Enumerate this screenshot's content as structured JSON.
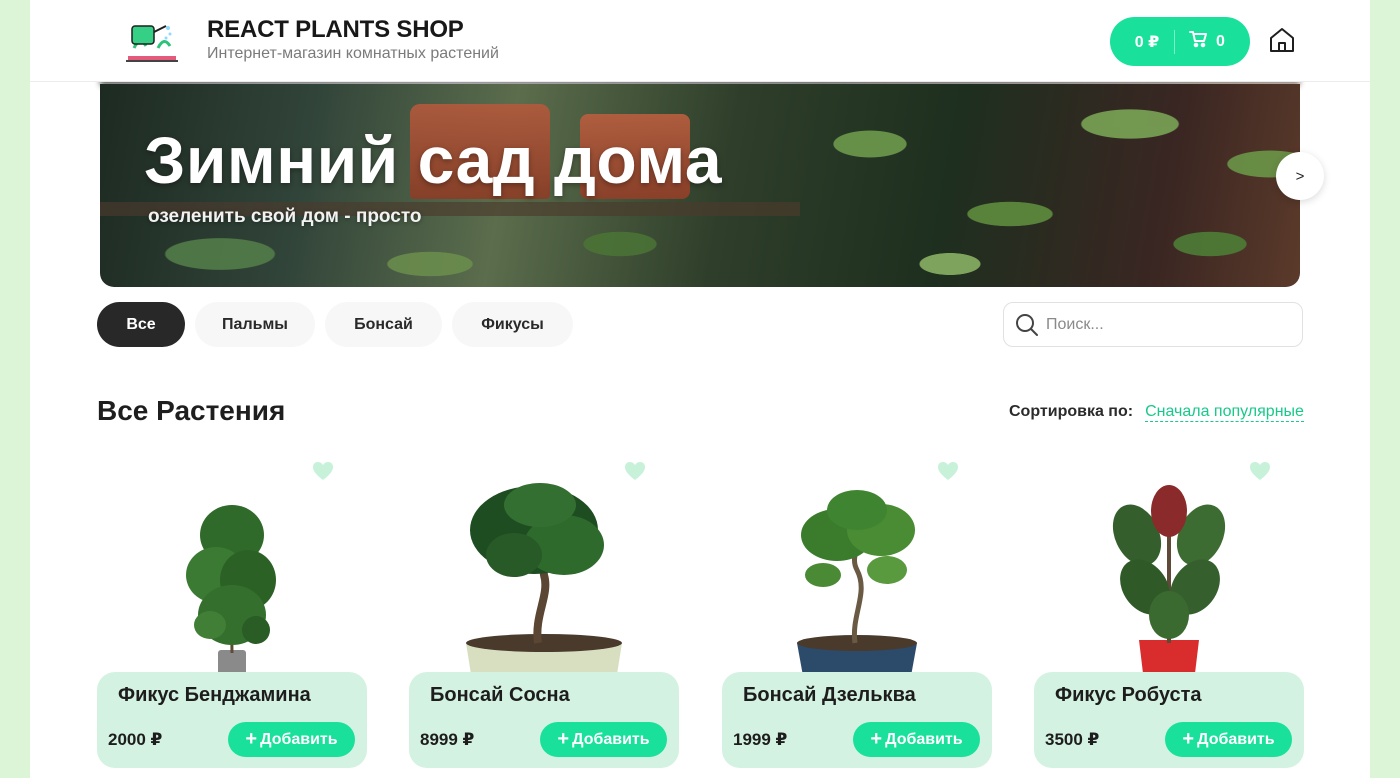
{
  "header": {
    "title": "REACT PLANTS SHOP",
    "subtitle": "Интернет-магазин комнатных растений",
    "cart": {
      "total": "0 ₽",
      "count": "0"
    }
  },
  "banner": {
    "title": "Зимний сад дома",
    "subtitle": "озеленить свой дом - просто",
    "next_label": ">"
  },
  "categories": [
    {
      "label": "Все",
      "active": true
    },
    {
      "label": "Пальмы",
      "active": false
    },
    {
      "label": "Бонсай",
      "active": false
    },
    {
      "label": "Фикусы",
      "active": false
    }
  ],
  "search": {
    "placeholder": "Поиск...",
    "value": ""
  },
  "section": {
    "title": "Все Растения",
    "sort_label": "Сортировка по:",
    "sort_value": "Сначала популярные"
  },
  "products": [
    {
      "name": "Фикус Бенджамина",
      "price": "2000 ₽",
      "add_label": "Добавить"
    },
    {
      "name": "Бонсай Сосна",
      "price": "8999 ₽",
      "add_label": "Добавить"
    },
    {
      "name": "Бонсай Дзельква",
      "price": "1999 ₽",
      "add_label": "Добавить"
    },
    {
      "name": "Фикус Робуста",
      "price": "3500 ₽",
      "add_label": "Добавить"
    }
  ],
  "colors": {
    "accent": "#19e19b",
    "card_bg": "#d4f2e2",
    "page_bg": "#dcf5d6",
    "heart": "#c7f2d9"
  }
}
